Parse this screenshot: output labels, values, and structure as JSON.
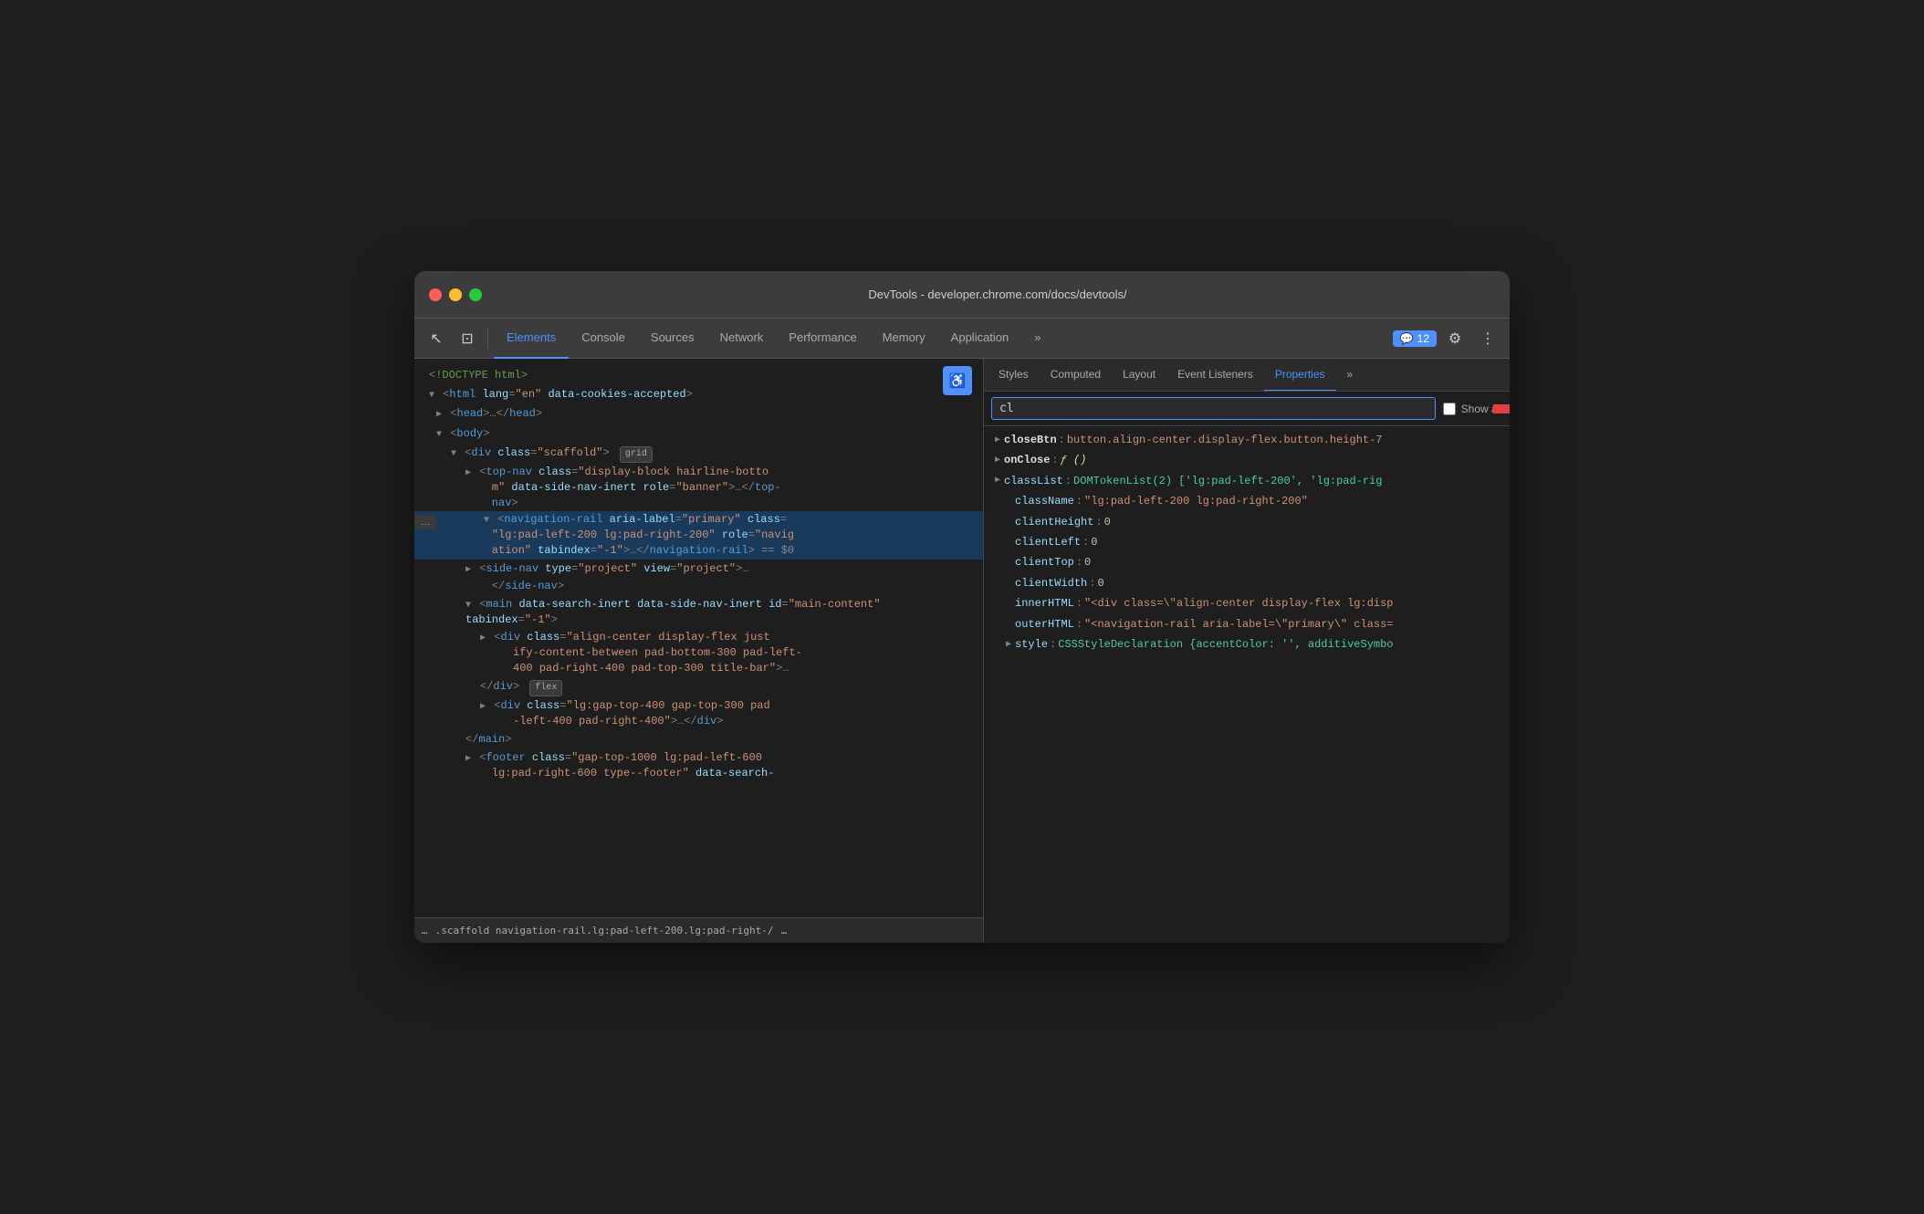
{
  "window": {
    "title": "DevTools - developer.chrome.com/docs/devtools/"
  },
  "toolbar": {
    "tabs": [
      {
        "label": "Elements",
        "active": true
      },
      {
        "label": "Console",
        "active": false
      },
      {
        "label": "Sources",
        "active": false
      },
      {
        "label": "Network",
        "active": false
      },
      {
        "label": "Performance",
        "active": false
      },
      {
        "label": "Memory",
        "active": false
      },
      {
        "label": "Application",
        "active": false
      }
    ],
    "more_label": "»",
    "chat_count": "12",
    "settings_icon": "⚙",
    "more_icon": "⋮"
  },
  "subtabs": [
    {
      "label": "Styles"
    },
    {
      "label": "Computed"
    },
    {
      "label": "Layout"
    },
    {
      "label": "Event Listeners"
    },
    {
      "label": "Properties",
      "active": true
    },
    {
      "label": "»"
    }
  ],
  "filter": {
    "value": "cl",
    "placeholder": "",
    "show_all_label": "Show all"
  },
  "dom": {
    "lines": [
      {
        "indent": 0,
        "content": "<!DOCTYPE html>",
        "type": "comment"
      },
      {
        "indent": 0,
        "content": "<html lang=\"en\" data-cookies-accepted>",
        "type": "tag"
      },
      {
        "indent": 1,
        "content": "▶<head>…</head>",
        "type": "collapsed"
      },
      {
        "indent": 1,
        "content": "▼<body>",
        "type": "tag"
      },
      {
        "indent": 2,
        "content": "▼<div class=\"scaffold\">",
        "type": "tag",
        "badge": "grid"
      },
      {
        "indent": 3,
        "content": "▶<top-nav class=\"display-block hairline-bottom\" data-side-nav-inert role=\"banner\">…</top-nav>",
        "type": "collapsed"
      },
      {
        "indent": 3,
        "content": "▼<navigation-rail aria-label=\"primary\" class=\"lg:pad-left-200 lg:pad-right-200\" role=\"navigation\" tabindex=\"-1\">…</navigation-rail> == $0",
        "type": "selected"
      },
      {
        "indent": 3,
        "content": "▶<side-nav type=\"project\" view=\"project\">…</side-nav>",
        "type": "collapsed"
      },
      {
        "indent": 3,
        "content": "▼<main data-search-inert data-side-nav-inert id=\"main-content\" tabindex=\"-1\">",
        "type": "tag"
      },
      {
        "indent": 4,
        "content": "▶<div class=\"align-center display-flex justify-content-between pad-bottom-300 pad-left-400 pad-right-400 pad-top-300 title-bar\">…",
        "type": "collapsed"
      },
      {
        "indent": 4,
        "content": "</div>",
        "type": "close",
        "badge": "flex"
      },
      {
        "indent": 4,
        "content": "▶<div class=\"lg:gap-top-400 gap-top-300 pad-left-400 pad-right-400\">…</div>",
        "type": "collapsed"
      },
      {
        "indent": 3,
        "content": "</main>",
        "type": "close"
      },
      {
        "indent": 3,
        "content": "▶<footer class=\"gap-top-1000 lg:pad-left-600 lg:pad-right-600 type--footer\" data-search-",
        "type": "collapsed"
      }
    ]
  },
  "properties": [
    {
      "key": "closeBtn",
      "value": "button.align-center.display-flex.button.height-7",
      "type": "expandable",
      "bold": true
    },
    {
      "key": "onClose",
      "value": "ƒ ()",
      "type": "expandable",
      "bold": true,
      "value_type": "func"
    },
    {
      "key": "classList",
      "value": "DOMTokenList(2) ['lg:pad-left-200', 'lg:pad-rig",
      "type": "expandable",
      "value_type": "domtokenlist"
    },
    {
      "key": "className",
      "value": "\"lg:pad-left-200 lg:pad-right-200\"",
      "type": "plain",
      "value_type": "classname"
    },
    {
      "key": "clientHeight",
      "value": "0",
      "type": "plain",
      "value_type": "number"
    },
    {
      "key": "clientLeft",
      "value": "0",
      "type": "plain",
      "value_type": "number"
    },
    {
      "key": "clientTop",
      "value": "0",
      "type": "plain",
      "value_type": "number"
    },
    {
      "key": "clientWidth",
      "value": "0",
      "type": "plain",
      "value_type": "number"
    },
    {
      "key": "innerHTML",
      "value": "\"<div class=\\\"align-center display-flex lg:disp",
      "type": "plain",
      "value_type": "string"
    },
    {
      "key": "outerHTML",
      "value": "\"<navigation-rail aria-label=\\\"primary\\\" class=",
      "type": "plain",
      "value_type": "string"
    },
    {
      "key": "style",
      "value": "CSSStyleDeclaration {accentColor: '', additiveSymbo",
      "type": "expandable",
      "value_type": "domtokenlist"
    }
  ],
  "statusbar": {
    "breadcrumb": ".scaffold   navigation-rail.lg:pad-left-200.lg:pad-right-/"
  },
  "icons": {
    "cursor": "↖",
    "layers": "⊡",
    "accessibility": "♿",
    "more_tabs": "»",
    "settings": "⚙",
    "overflow": "⋮",
    "chat": "💬"
  }
}
